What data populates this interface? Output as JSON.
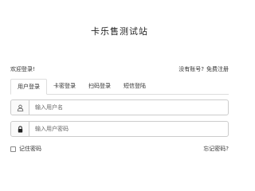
{
  "header": {
    "title": "卡乐售测试站"
  },
  "welcome": {
    "text": "欢迎登录!",
    "no_account": "没有账号?",
    "register": "免费注册"
  },
  "tabs": [
    {
      "label": "用户登录",
      "active": true
    },
    {
      "label": "卡密登录",
      "active": false
    },
    {
      "label": "扫码登录",
      "active": false
    },
    {
      "label": "短信登陆",
      "active": false
    }
  ],
  "form": {
    "username": {
      "placeholder": "输入用户名",
      "value": "",
      "icon": "user-icon"
    },
    "password": {
      "placeholder": "输入用户密码",
      "value": "",
      "icon": "lock-icon"
    }
  },
  "remember": {
    "label": "记住密码",
    "checked": false
  },
  "forgot": {
    "label": "忘记密码?"
  }
}
